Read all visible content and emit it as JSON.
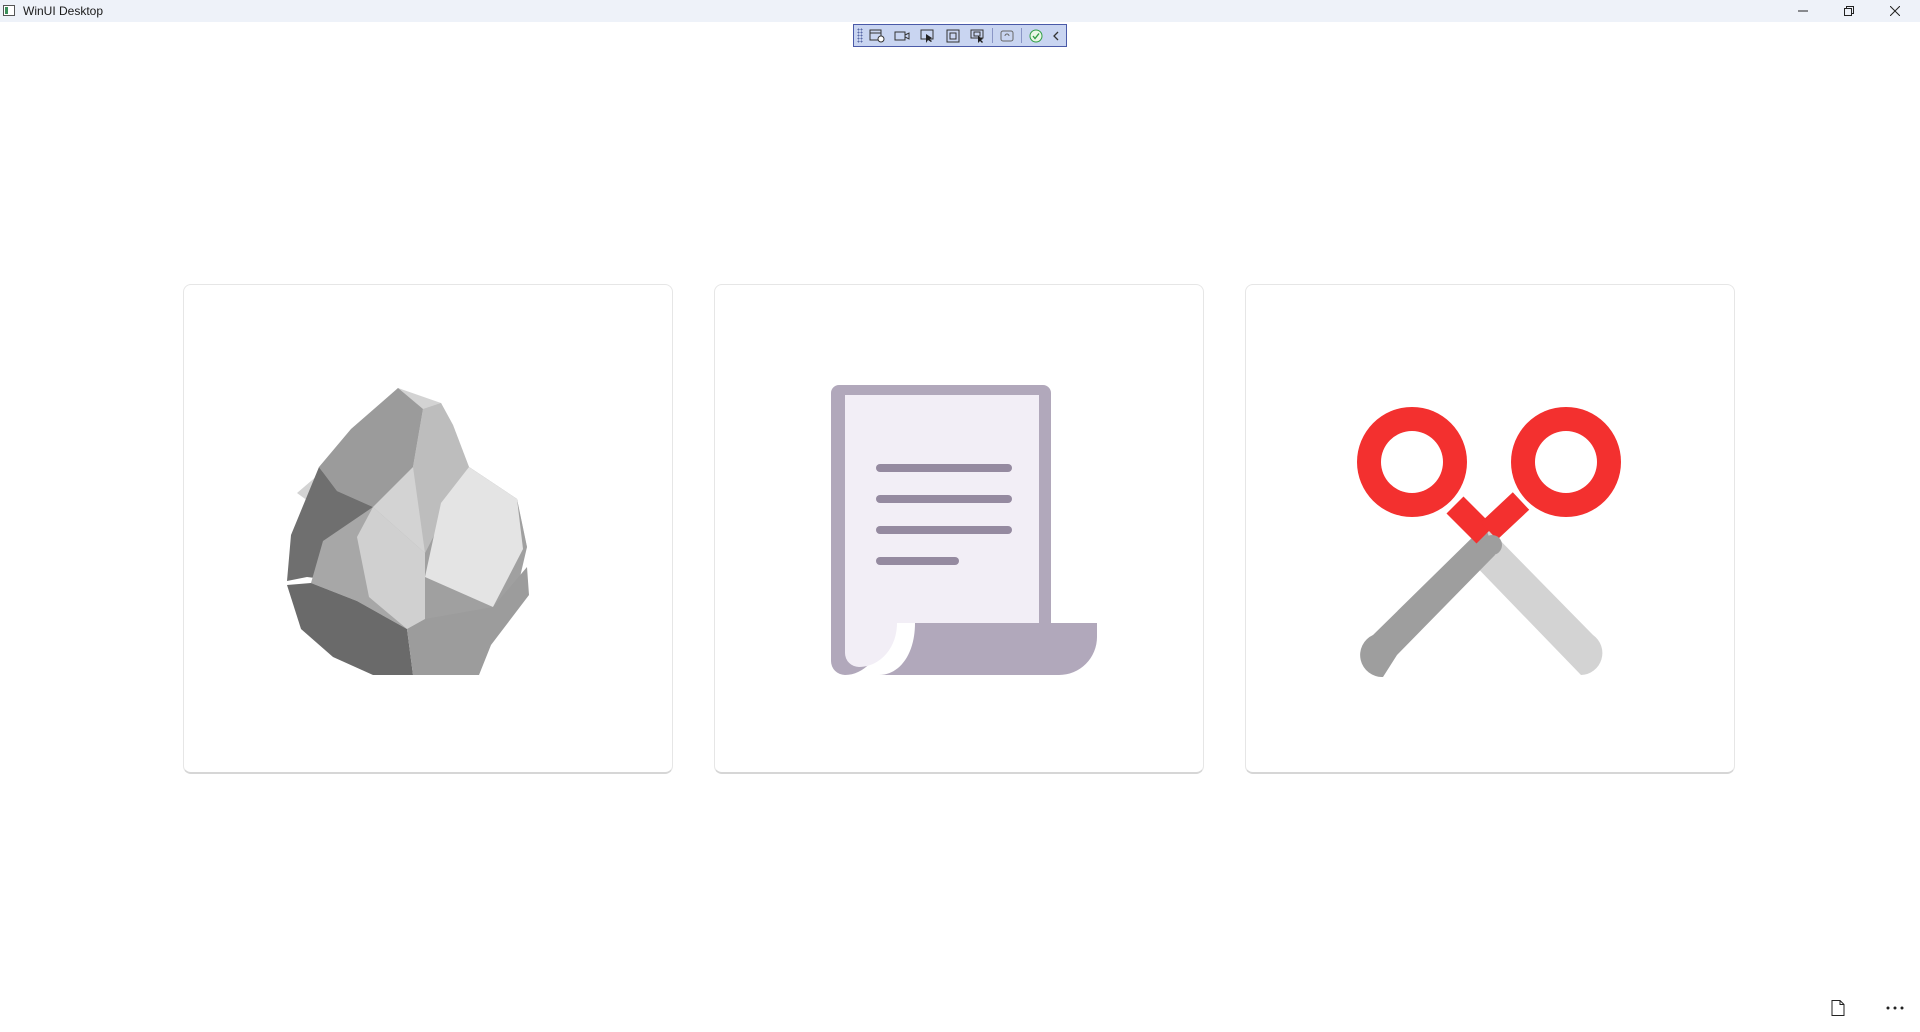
{
  "window": {
    "title": "WinUI Desktop",
    "controls": [
      "minimize-icon",
      "restore-icon",
      "close-icon"
    ]
  },
  "debug_toolbar": {
    "icons": [
      "live-visual-tree-icon",
      "record-icon",
      "select-element-icon",
      "display-layout-adorners-icon",
      "track-focused-element-icon",
      "hot-reload-icon",
      "binding-failures-check-icon",
      "collapse-chevron-icon"
    ]
  },
  "cards": [
    {
      "id": "rock",
      "icon": "rock-icon"
    },
    {
      "id": "paper",
      "icon": "paper-scroll-icon"
    },
    {
      "id": "scissors",
      "icon": "scissors-icon"
    }
  ],
  "bottom_bar": {
    "icons": [
      "page-icon",
      "more-options-icon"
    ]
  },
  "colors": {
    "titlebar_bg": "#eef2f9",
    "toolbar_bg": "#c9d5f1",
    "scissors_red": "#f3302f",
    "paper_purple": "#b1a8bb"
  }
}
